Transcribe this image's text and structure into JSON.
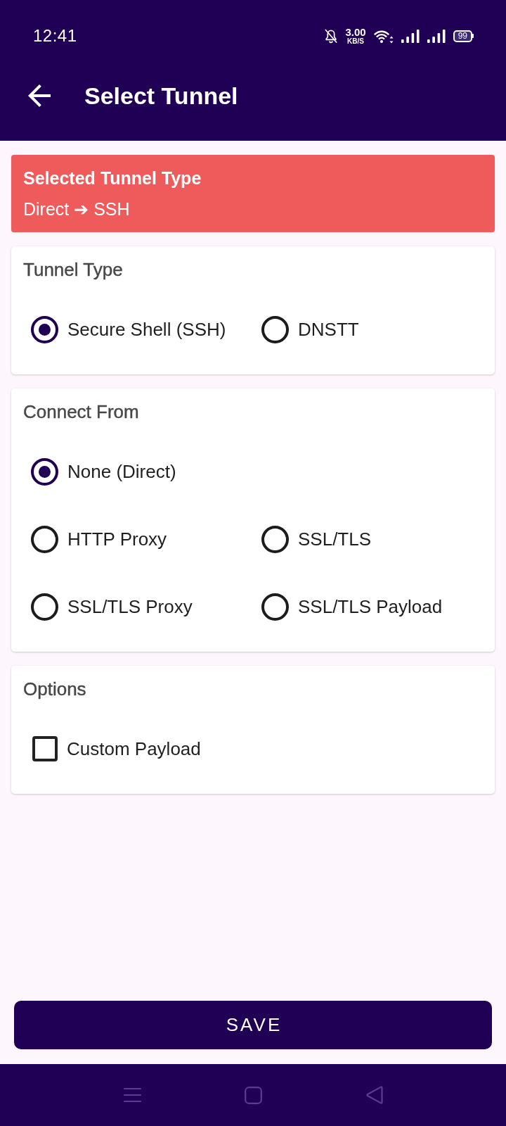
{
  "status_bar": {
    "time": "12:41",
    "net_speed": "3.00",
    "net_speed_unit": "KB/S",
    "battery": "99"
  },
  "app_bar": {
    "title": "Select Tunnel"
  },
  "summary": {
    "title": "Selected Tunnel Type",
    "value": "Direct ➔ SSH"
  },
  "sections": [
    {
      "title": "Tunnel Type",
      "kind": "radio",
      "rows": [
        {
          "options": [
            {
              "label": "Secure Shell (SSH)",
              "selected": true
            },
            {
              "label": "DNSTT",
              "selected": false
            }
          ]
        }
      ]
    },
    {
      "title": "Connect From",
      "kind": "radio",
      "rows": [
        {
          "options": [
            {
              "label": "None (Direct)",
              "selected": true
            }
          ]
        },
        {
          "options": [
            {
              "label": "HTTP Proxy",
              "selected": false
            },
            {
              "label": "SSL/TLS",
              "selected": false
            }
          ]
        },
        {
          "options": [
            {
              "label": "SSL/TLS Proxy",
              "selected": false
            },
            {
              "label": "SSL/TLS Payload",
              "selected": false
            }
          ]
        }
      ]
    },
    {
      "title": "Options",
      "kind": "checkbox",
      "rows": [
        {
          "options": [
            {
              "label": "Custom Payload",
              "checked": false
            }
          ]
        }
      ]
    }
  ],
  "save_button": {
    "label": "SAVE"
  }
}
